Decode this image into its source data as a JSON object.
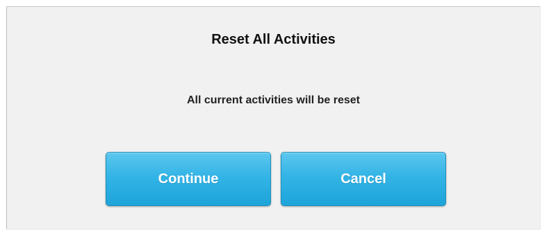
{
  "dialog": {
    "title": "Reset All Activities",
    "message": "All current activities will be reset",
    "buttons": {
      "continue_label": "Continue",
      "cancel_label": "Cancel"
    }
  },
  "colors": {
    "dialog_background": "#f1f1f1",
    "button_top": "#5cc7ee",
    "button_bottom": "#1ea4da",
    "button_text": "#ffffff"
  }
}
